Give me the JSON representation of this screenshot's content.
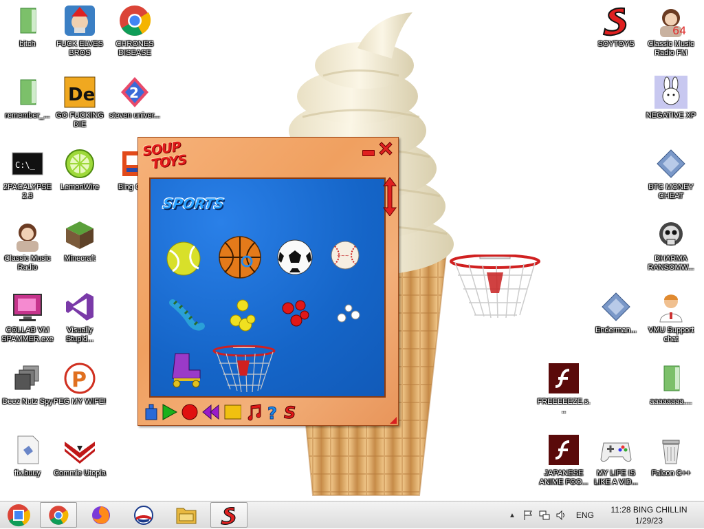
{
  "desktop": {
    "icons": [
      {
        "label": "bitch",
        "icon": "green-file-icon"
      },
      {
        "label": "FUCK ELVES BROS",
        "icon": "elf-app-icon"
      },
      {
        "label": "CHRONES DISEASE",
        "icon": "chrome-icon"
      },
      {
        "label": "remember_...",
        "icon": "green-file-icon"
      },
      {
        "label": "GO FUCKING DIE",
        "icon": "de-app-icon"
      },
      {
        "label": "steven univer...",
        "icon": "steven-universe-icon"
      },
      {
        "label": "2PACALYPSE 2.3",
        "icon": "cmd-icon"
      },
      {
        "label": "LemonWire",
        "icon": "lemonwire-icon"
      },
      {
        "label": "Bing Ch...",
        "icon": "bing-chat-icon"
      },
      {
        "label": "Classic Music Radio",
        "icon": "portrait-icon"
      },
      {
        "label": "Minecraft",
        "icon": "minecraft-icon"
      },
      {
        "label": "COLLAB VM SPAMMER.exe",
        "icon": "monitor-icon"
      },
      {
        "label": "Visually Stupid...",
        "icon": "visual-studio-icon"
      },
      {
        "label": "Deez Nutz Spy",
        "icon": "windows-stack-icon"
      },
      {
        "label": "PEG MY WIFE!",
        "icon": "peg-icon"
      },
      {
        "label": "fix.buuy",
        "icon": "script-file-icon"
      },
      {
        "label": "Commie Utopia",
        "icon": "commie-icon"
      },
      {
        "label": "SOYTOYS",
        "icon": "soup-toys-icon"
      },
      {
        "label": "Classic Music Radio FM",
        "icon": "portrait-icon"
      },
      {
        "label": "NEGATIVE XP",
        "icon": "bunny-icon"
      },
      {
        "label": "BTC MONEY CHEAT",
        "icon": "diamond-icon"
      },
      {
        "label": "DHARMA RANSOMW...",
        "icon": "skull-icon"
      },
      {
        "label": "Enderman...",
        "icon": "diamond-icon"
      },
      {
        "label": "VMU Support chat",
        "icon": "support-icon"
      },
      {
        "label": "FREEEEEZE.s...",
        "icon": "flash-icon"
      },
      {
        "label": "aaaaaaaa....",
        "icon": "green-file-icon"
      },
      {
        "label": "JAPANESE ANIME FOO...",
        "icon": "flash-icon"
      },
      {
        "label": "MY LIFE IS LIKE A VID...",
        "icon": "gamepad-icon"
      },
      {
        "label": "Falcon C++",
        "icon": "recycle-bin-icon"
      }
    ]
  },
  "soup_toys": {
    "logo_line1": "SOUP",
    "logo_line2": "TOYS",
    "category": "SPORTS",
    "toys": [
      "tennis-ball-icon",
      "basketball-icon",
      "soccer-ball-icon",
      "baseball-icon",
      "caterpillar-icon",
      "yellow-balls-icon",
      "red-balls-icon",
      "white-balls-icon",
      "roller-skate-icon",
      "basketball-hoop-icon"
    ],
    "toolbar": [
      "bucket-icon",
      "play-icon",
      "record-icon",
      "rewind-icon",
      "stop-icon",
      "music-icon",
      "help-icon",
      "soup-s-icon"
    ]
  },
  "taskbar": {
    "language": "ENG",
    "clock_time": "11:28 BING CHILLIN",
    "clock_date": "1/29/23"
  },
  "colors": {
    "window_orange": "#f0a060",
    "panel_blue": "#1a6ed8",
    "accent_red": "#e21b1b"
  }
}
